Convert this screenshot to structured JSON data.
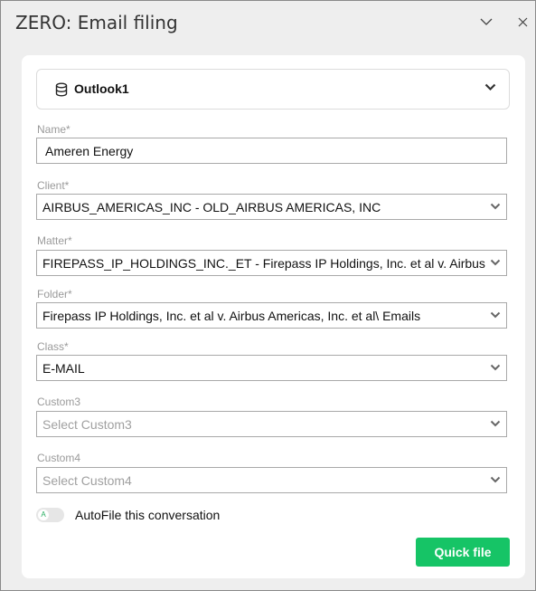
{
  "window": {
    "title": "ZERO: Email filing",
    "controls": [
      "chevron-down-icon",
      "close-icon"
    ]
  },
  "account": {
    "label": "Outlook1",
    "icon": "database-icon"
  },
  "form": {
    "name": {
      "label": "Name*",
      "value": "Ameren Energy"
    },
    "client": {
      "label": "Client*",
      "value": "AIRBUS_AMERICAS_INC - OLD_AIRBUS AMERICAS, INC"
    },
    "matter": {
      "label": "Matter*",
      "value": "FIREPASS_IP_HOLDINGS_INC._ET - Firepass IP Holdings, Inc. et al v. Airbus Americas, Inc. et al"
    },
    "folder": {
      "label": "Folder*",
      "value": "Firepass IP Holdings, Inc. et al v. Airbus Americas, Inc. et al\\ Emails"
    },
    "class": {
      "label": "Class*",
      "value": "E-MAIL"
    },
    "custom3": {
      "label": "Custom3",
      "placeholder": "Select Custom3"
    },
    "custom4": {
      "label": "Custom4",
      "placeholder": "Select Custom4"
    }
  },
  "autofile": {
    "knob_letter": "A",
    "label": "AutoFile this conversation",
    "enabled": false
  },
  "actions": {
    "quick_file": "Quick file"
  },
  "colors": {
    "accent_green": "#16c466",
    "window_bg": "#eeeeee",
    "card_bg": "#ffffff"
  }
}
